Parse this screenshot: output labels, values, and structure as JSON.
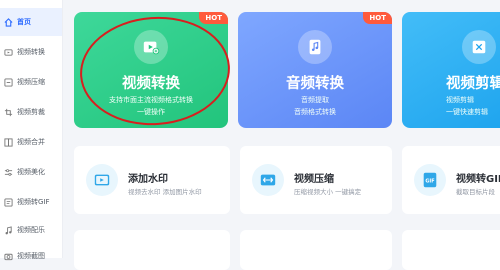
{
  "sidebar": {
    "items": [
      {
        "label": "首页",
        "icon": "home-icon",
        "active": true
      },
      {
        "label": "视频转换",
        "icon": "convert-icon"
      },
      {
        "label": "视频压缩",
        "icon": "compress-icon"
      },
      {
        "label": "视频剪裁",
        "icon": "crop-icon"
      },
      {
        "label": "视频合并",
        "icon": "merge-icon"
      },
      {
        "label": "视频美化",
        "icon": "beautify-icon"
      },
      {
        "label": "视频转GIF",
        "icon": "gif-icon"
      },
      {
        "label": "视频配乐",
        "icon": "music-icon"
      },
      {
        "label": "视频截图",
        "icon": "screenshot-icon"
      }
    ]
  },
  "feature_cards": [
    {
      "title": "视频转换",
      "subtitle_lines": [
        "支持市面主流视频格式转换",
        "一键操作"
      ],
      "badge": "HOT",
      "icon": "video-convert-icon",
      "color": "#22c47c"
    },
    {
      "title": "音频转换",
      "subtitle_lines": [
        "音频提取",
        "音频格式转换"
      ],
      "badge": "HOT",
      "icon": "audio-convert-icon",
      "color": "#5b86f5"
    },
    {
      "title": "视频剪辑",
      "subtitle_lines": [
        "视频剪辑",
        "一键快速剪辑"
      ],
      "badge": "",
      "icon": "video-edit-icon",
      "color": "#1ea4ee"
    }
  ],
  "tool_cards": [
    {
      "title": "添加水印",
      "subtitle": "视频去水印 添加图片水印",
      "icon": "watermark-icon"
    },
    {
      "title": "视频压缩",
      "subtitle": "压缩视频大小 一键搞定",
      "icon": "video-compress-icon"
    },
    {
      "title": "视频转GIF",
      "subtitle": "截取目标片段",
      "icon": "gif-icon"
    }
  ],
  "colors": {
    "accent": "#2d6bff",
    "hot": "#ff5a3c",
    "annotation": "#d81e1e"
  }
}
